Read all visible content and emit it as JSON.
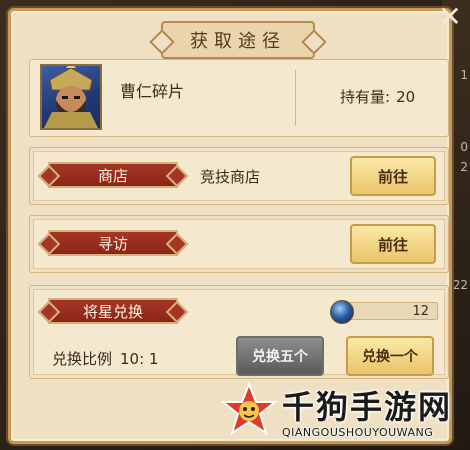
{
  "dialog": {
    "title": "获取途径",
    "close_glyph": "✕"
  },
  "item": {
    "name": "曹仁碎片",
    "own_label": "持有量:",
    "own_value": "20"
  },
  "sources": [
    {
      "tag": "商店",
      "desc": "竞技商店",
      "button": "前往"
    },
    {
      "tag": "寻访",
      "desc": "",
      "button": "前往"
    }
  ],
  "exchange": {
    "tag": "将星兑换",
    "currency_count": "12",
    "ratio_label": "兑换比例",
    "ratio_value": "10: 1",
    "btn_five": "兑换五个",
    "btn_one": "兑换一个"
  },
  "background_edge": {
    "lines": [
      "1",
      "0",
      "2",
      "22"
    ]
  },
  "watermark": {
    "brand": "千狗手游网",
    "url": "QIANGOUSHOUYOUWANG"
  },
  "colors": {
    "panel": "#efe0c3",
    "tag_red": "#a53626",
    "button_gold": "#eac56a",
    "button_gray": "#5a5a5a"
  }
}
